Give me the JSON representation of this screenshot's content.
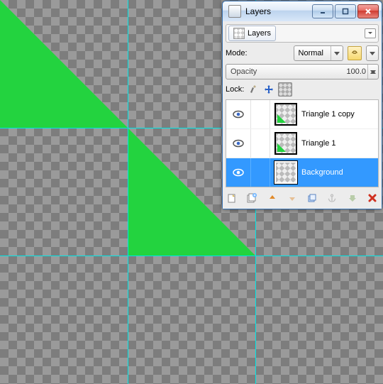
{
  "window": {
    "title": "Layers",
    "tab_label": "Layers"
  },
  "mode": {
    "label": "Mode:",
    "value": "Normal"
  },
  "opacity": {
    "label": "Opacity",
    "value": "100.0"
  },
  "lock": {
    "label": "Lock:"
  },
  "layers": [
    {
      "name": "Triangle 1 copy",
      "visible": true,
      "has_triangle": true,
      "selected": false
    },
    {
      "name": "Triangle 1",
      "visible": true,
      "has_triangle": true,
      "selected": false
    },
    {
      "name": "Background",
      "visible": true,
      "has_triangle": false,
      "selected": true
    }
  ],
  "icons": {
    "minimize": "minimize-icon",
    "maximize": "maximize-icon",
    "close": "close-icon"
  },
  "guides": {
    "v1": 180,
    "v2": 360,
    "h1": 180,
    "h2": 360
  },
  "colors": {
    "triangle": "#23d33f",
    "guide": "#00e6e6",
    "selection": "#3399ff"
  }
}
